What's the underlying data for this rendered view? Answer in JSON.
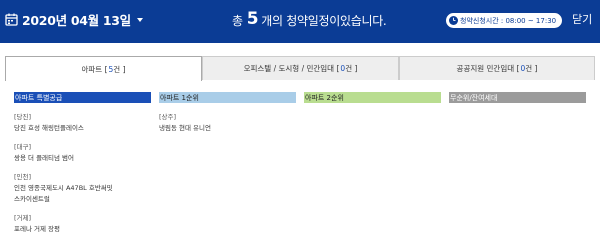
{
  "header": {
    "date": "2020년 04월 13일",
    "summary_prefix": "총",
    "summary_count": "5",
    "summary_suffix": "개의 청약일정이있습니다.",
    "time_badge": "청약신청시간 : 08:00 ~ 17:30",
    "close_label": "닫기"
  },
  "tabs": [
    {
      "label": "아파트 [",
      "count": "5",
      "suffix": "건 ]",
      "active": true
    },
    {
      "label": "오피스텔 / 도시형 / 민간임대 [",
      "count": "0",
      "suffix": "건 ]",
      "active": false
    },
    {
      "label": "공공지원 민간임대 [",
      "count": "0",
      "suffix": "건 ]",
      "active": false
    }
  ],
  "columns": [
    {
      "title": "아파트 특별공급",
      "items": [
        {
          "region": "[당진]",
          "lines": [
            "당진 효성 해링턴플레이스"
          ]
        },
        {
          "region": "[대구]",
          "lines": [
            "쌍용 더 플래티넘 범어"
          ]
        },
        {
          "region": "[인천]",
          "lines": [
            "인천 영종국제도시 A47BL 호반써밋",
            "스카이센트럴"
          ]
        },
        {
          "region": "[거제]",
          "lines": [
            "포레나 거제 장평"
          ]
        }
      ]
    },
    {
      "title": "아파트 1순위",
      "items": [
        {
          "region": "[상주]",
          "lines": [
            "냉림동 현대 유니언"
          ]
        }
      ]
    },
    {
      "title": "아파트 2순위",
      "items": []
    },
    {
      "title": "무순위/잔여세대",
      "items": []
    }
  ],
  "colors": {
    "header_bg": "#0b3c95",
    "special_supply": "#1a4fb7",
    "first_priority": "#a9cde8",
    "second_priority": "#b9dd90",
    "no_priority": "#9b9b9b"
  }
}
